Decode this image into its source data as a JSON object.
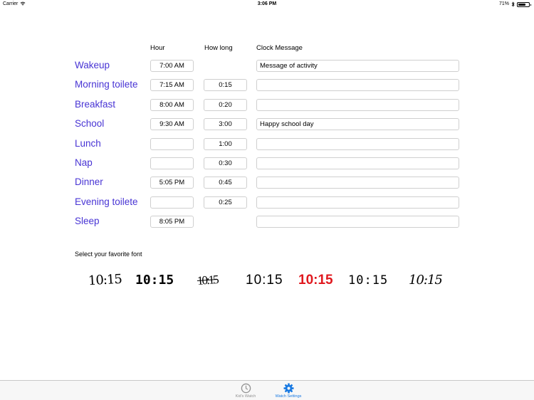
{
  "status_bar": {
    "carrier": "Carrier",
    "time": "3:06 PM",
    "battery": "71%",
    "battery_level": 0.71
  },
  "headers": {
    "hour": "Hour",
    "how_long": "How long",
    "message": "Clock Message"
  },
  "rows": [
    {
      "label": "Wakeup",
      "hour": "7:00 AM",
      "duration": null,
      "message": "Message of activity"
    },
    {
      "label": "Morning toilete",
      "hour": "7:15 AM",
      "duration": "0:15",
      "message": ""
    },
    {
      "label": "Breakfast",
      "hour": "8:00 AM",
      "duration": "0:20",
      "message": ""
    },
    {
      "label": "School",
      "hour": "9:30 AM",
      "duration": "3:00",
      "message": "Happy school day"
    },
    {
      "label": "Lunch",
      "hour": "",
      "duration": "1:00",
      "message": ""
    },
    {
      "label": "Nap",
      "hour": "",
      "duration": "0:30",
      "message": ""
    },
    {
      "label": "Dinner",
      "hour": "5:05 PM",
      "duration": "0:45",
      "message": ""
    },
    {
      "label": "Evening toilete",
      "hour": "",
      "duration": "0:25",
      "message": ""
    },
    {
      "label": "Sleep",
      "hour": "8:05 PM",
      "duration": null,
      "message": ""
    }
  ],
  "font_section": {
    "caption": "Select your favorite font",
    "samples": [
      {
        "text": "10:15",
        "color": "#000000"
      },
      {
        "text": "10:15",
        "color": "#000000"
      },
      {
        "text": "10:15",
        "color": "#000000"
      },
      {
        "text": "10:15",
        "color": "#000000"
      },
      {
        "text": "10:15",
        "color": "#e0191f"
      },
      {
        "text": "10:15",
        "color": "#000000"
      },
      {
        "text": "10:15",
        "color": "#000000"
      }
    ]
  },
  "tab_bar": {
    "tabs": [
      {
        "label": "Kid's Watch",
        "icon": "clock-icon",
        "selected": false
      },
      {
        "label": "Watch Settings",
        "icon": "gear-icon",
        "selected": true
      }
    ],
    "active_color": "#1a7ae2",
    "inactive_color": "#929292"
  },
  "colors": {
    "row_label": "#4834d4"
  }
}
